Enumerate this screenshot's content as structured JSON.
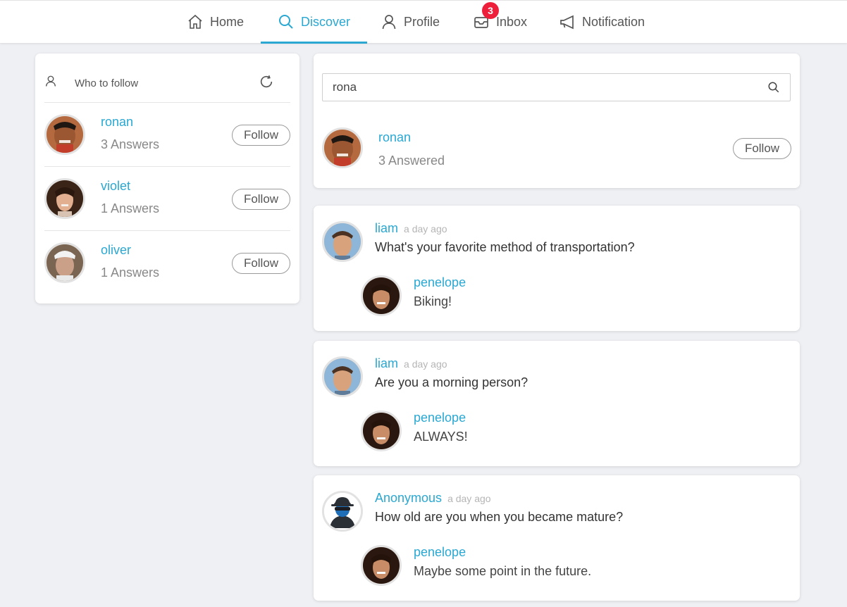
{
  "nav": {
    "items": [
      {
        "label": "Home",
        "icon": "home-icon"
      },
      {
        "label": "Discover",
        "icon": "search-icon",
        "active": true
      },
      {
        "label": "Profile",
        "icon": "user-icon"
      },
      {
        "label": "Inbox",
        "icon": "inbox-icon",
        "badge": "3"
      },
      {
        "label": "Notification",
        "icon": "megaphone-icon"
      }
    ]
  },
  "colors": {
    "accent": "#2aa8d2",
    "badge": "#ee1f3a",
    "background": "#eff0f4"
  },
  "who_to_follow": {
    "title": "Who to follow",
    "suggestions": [
      {
        "name": "ronan",
        "meta": "3 Answers",
        "button": "Follow"
      },
      {
        "name": "violet",
        "meta": "1 Answers",
        "button": "Follow"
      },
      {
        "name": "oliver",
        "meta": "1 Answers",
        "button": "Follow"
      }
    ]
  },
  "search": {
    "value": "rona",
    "result": {
      "name": "ronan",
      "meta": "3 Answered",
      "button": "Follow"
    }
  },
  "feed": [
    {
      "author": "liam",
      "time": "a day ago",
      "question": "What's your favorite method of transportation?",
      "answer_author": "penelope",
      "answer": "Biking!"
    },
    {
      "author": "liam",
      "time": "a day ago",
      "question": "Are you a morning person?",
      "answer_author": "penelope",
      "answer": "ALWAYS!"
    },
    {
      "author": "Anonymous",
      "time": "a day ago",
      "question": "How old are you when you became mature?",
      "answer_author": "penelope",
      "answer": "Maybe some point in the future."
    }
  ]
}
